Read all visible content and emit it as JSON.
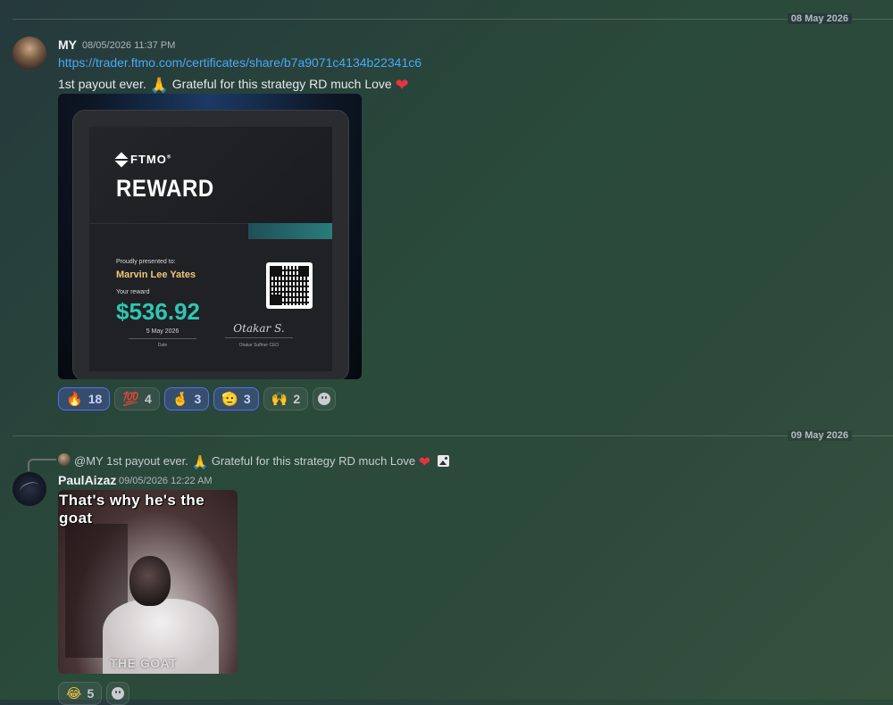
{
  "dividers": [
    {
      "label": "08 May 2026"
    },
    {
      "label": "09 May 2026"
    }
  ],
  "message1": {
    "username": "MY",
    "timestamp": "08/05/2026 11:37 PM",
    "link": "https://trader.ftmo.com/certificates/share/b7a9071c4134b22341c6",
    "text_before": "1st payout ever.",
    "text_middle": "Grateful for this strategy RD much Love",
    "emoji_pray": "🙏",
    "emoji_heart": "❤",
    "certificate": {
      "brand": "FTMO",
      "brand_mark": "®",
      "title": "REWARD",
      "presented_label": "Proudly presented to:",
      "recipient": "Marvin Lee Yates",
      "reward_label": "Your reward",
      "amount": "$536.92",
      "date": "5 May 2026",
      "date_label": "Date",
      "signature": "Otakar S.",
      "signature_label": "Otakar Suffner CEO"
    },
    "reactions": [
      {
        "emoji": "🔥",
        "count": "18",
        "me": true
      },
      {
        "emoji": "💯",
        "count": "4",
        "me": false
      },
      {
        "emoji": "🤞",
        "count": "3",
        "me": true
      },
      {
        "emoji": "🫡",
        "count": "3",
        "me": true
      },
      {
        "emoji": "🙌",
        "count": "2",
        "me": false
      }
    ]
  },
  "message2": {
    "reply": {
      "mention": "@MY",
      "text": "1st payout ever.",
      "text_middle": "Grateful for this strategy RD much Love",
      "emoji_pray": "🙏",
      "emoji_heart": "❤"
    },
    "username": "PaulAizaz",
    "timestamp": "09/05/2026 12:22 AM",
    "gif": {
      "caption": "That's why he's the goat",
      "watermark": "THE GOAT"
    },
    "reactions": [
      {
        "emoji": "😂",
        "count": "5",
        "me": false
      }
    ]
  },
  "icons": {
    "add_reaction": "smiley-face-icon",
    "image": "image-icon"
  }
}
